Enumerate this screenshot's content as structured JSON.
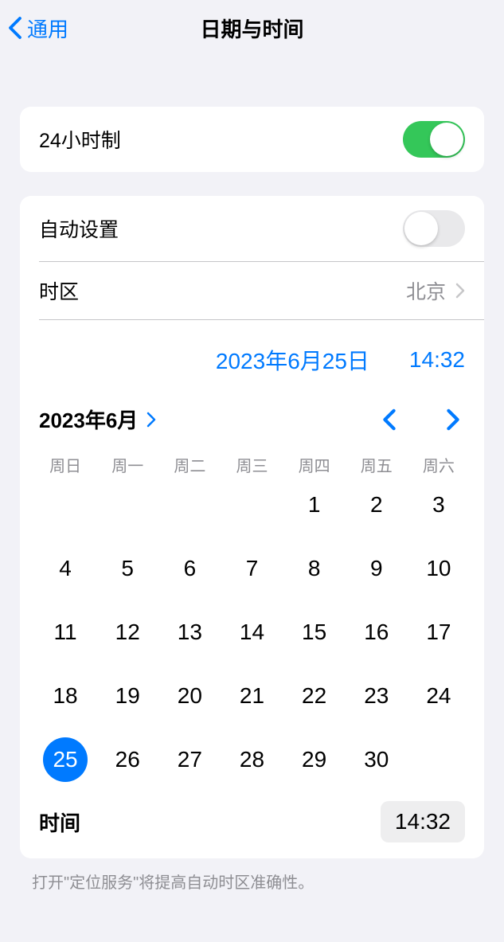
{
  "header": {
    "back_label": "通用",
    "title": "日期与时间"
  },
  "settings": {
    "hour24_label": "24小时制",
    "hour24_enabled": true,
    "auto_set_label": "自动设置",
    "auto_set_enabled": false,
    "timezone_label": "时区",
    "timezone_value": "北京"
  },
  "datetime": {
    "selected_date": "2023年6月25日",
    "selected_time": "14:32"
  },
  "calendar": {
    "month_label": "2023年6月",
    "weekdays": [
      "周日",
      "周一",
      "周二",
      "周三",
      "周四",
      "周五",
      "周六"
    ],
    "leading_blanks": 4,
    "days": [
      1,
      2,
      3,
      4,
      5,
      6,
      7,
      8,
      9,
      10,
      11,
      12,
      13,
      14,
      15,
      16,
      17,
      18,
      19,
      20,
      21,
      22,
      23,
      24,
      25,
      26,
      27,
      28,
      29,
      30
    ],
    "selected_day": 25
  },
  "time_section": {
    "label": "时间",
    "value": "14:32"
  },
  "footer": {
    "hint": "打开\"定位服务\"将提高自动时区准确性。"
  },
  "colors": {
    "accent": "#007aff",
    "toggle_on": "#34c759"
  }
}
